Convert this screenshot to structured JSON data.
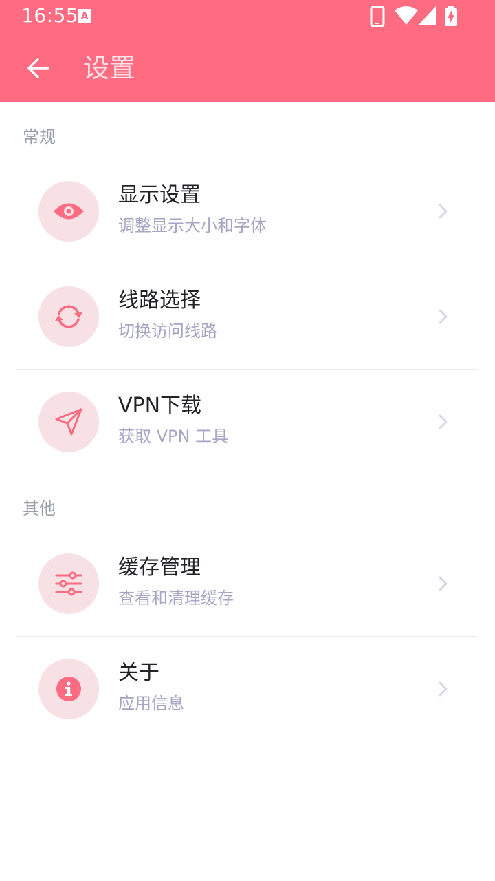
{
  "status_bar": {
    "time": "16:55",
    "notification_icon": "a-notification-icon",
    "icons": [
      "phone-icon",
      "wifi-icon",
      "signal-icon",
      "battery-charging-icon"
    ]
  },
  "toolbar": {
    "back_icon": "arrow-left-icon",
    "title": "设置"
  },
  "colors": {
    "accent": "#ff6b80",
    "icon_bg": "#f7e1e5",
    "title_text": "#222228",
    "subtitle_text": "#a6a6c4",
    "section_text": "#9aa0aa",
    "chevron": "#d6d6e4"
  },
  "sections": [
    {
      "label": "常规",
      "items": [
        {
          "icon": "eye-icon",
          "title": "显示设置",
          "subtitle": "调整显示大小和字体"
        },
        {
          "icon": "sync-icon",
          "title": "线路选择",
          "subtitle": "切换访问线路"
        },
        {
          "icon": "send-icon",
          "title": "VPN下载",
          "subtitle": "获取 VPN 工具"
        }
      ]
    },
    {
      "label": "其他",
      "items": [
        {
          "icon": "sliders-icon",
          "title": "缓存管理",
          "subtitle": "查看和清理缓存"
        },
        {
          "icon": "info-icon",
          "title": "关于",
          "subtitle": "应用信息"
        }
      ]
    }
  ]
}
